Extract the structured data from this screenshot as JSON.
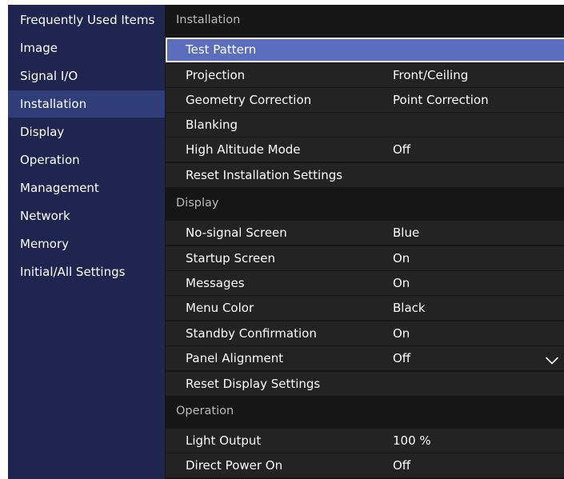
{
  "sidebar": {
    "items": [
      {
        "label": "Frequently Used Items"
      },
      {
        "label": "Image"
      },
      {
        "label": "Signal I/O"
      },
      {
        "label": "Installation"
      },
      {
        "label": "Display"
      },
      {
        "label": "Operation"
      },
      {
        "label": "Management"
      },
      {
        "label": "Network"
      },
      {
        "label": "Memory"
      },
      {
        "label": "Initial/All Settings"
      }
    ],
    "selected": "Installation"
  },
  "sections": [
    {
      "title": "Installation",
      "rows": [
        {
          "label": "Test Pattern",
          "value": ""
        },
        {
          "label": "Projection",
          "value": "Front/Ceiling"
        },
        {
          "label": "Geometry Correction",
          "value": "Point Correction"
        },
        {
          "label": "Blanking",
          "value": ""
        },
        {
          "label": "High Altitude Mode",
          "value": "Off"
        },
        {
          "label": "Reset Installation Settings",
          "value": ""
        }
      ]
    },
    {
      "title": "Display",
      "rows": [
        {
          "label": "No-signal Screen",
          "value": "Blue"
        },
        {
          "label": "Startup Screen",
          "value": "On"
        },
        {
          "label": "Messages",
          "value": "On"
        },
        {
          "label": "Menu Color",
          "value": "Black"
        },
        {
          "label": "Standby Confirmation",
          "value": "On"
        },
        {
          "label": "Panel Alignment",
          "value": "Off"
        },
        {
          "label": "Reset Display Settings",
          "value": ""
        }
      ]
    },
    {
      "title": "Operation",
      "rows": [
        {
          "label": "Light Output",
          "value": "100 %"
        },
        {
          "label": "Direct Power On",
          "value": "Off"
        }
      ]
    }
  ],
  "highlighted_row": "Test Pattern",
  "scroll_indicator_icon": "chevron-down-icon",
  "colors": {
    "sidebar_bg": "#1e2650",
    "sidebar_selected": "#2f3d78",
    "highlight": "#5a6ebd",
    "row_bg": "#232323",
    "background": "#161616"
  }
}
